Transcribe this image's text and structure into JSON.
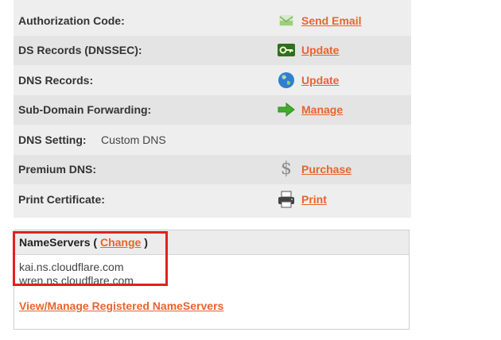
{
  "domain_settings": {
    "rows": [
      {
        "label": "Authorization Code:",
        "action": "Send Email",
        "icon": "envelope-icon"
      },
      {
        "label": "DS Records (DNSSEC):",
        "action": "Update",
        "icon": "key-icon"
      },
      {
        "label": "DNS Records:",
        "action": "Update",
        "icon": "globe-icon"
      },
      {
        "label": "Sub-Domain Forwarding:",
        "action": "Manage",
        "icon": "arrow-right-icon"
      },
      {
        "label": "DNS Setting:",
        "value": "Custom DNS"
      },
      {
        "label": "Premium DNS:",
        "action": "Purchase",
        "icon": "dollar-icon"
      },
      {
        "label": "Print Certificate:",
        "action": "Print",
        "icon": "printer-icon"
      }
    ]
  },
  "nameservers": {
    "title": "NameServers",
    "open_paren": " ( ",
    "change_label": "Change",
    "close_paren": " )",
    "servers": [
      "kai.ns.cloudflare.com",
      "wren.ns.cloudflare.com"
    ],
    "manage_link": "View/Manage Registered NameServers"
  },
  "colors": {
    "link": "#e8642c",
    "highlight_border": "#e02020",
    "panel_bg": "#eeeeee"
  }
}
